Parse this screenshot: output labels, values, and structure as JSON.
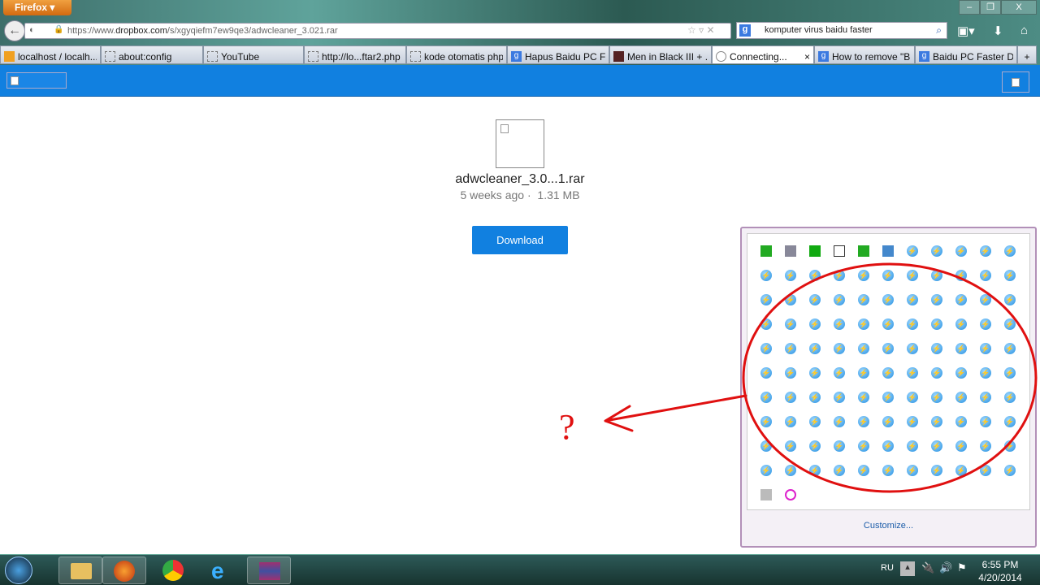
{
  "browser": {
    "menu_button": "Firefox",
    "window_controls": [
      "–",
      "❐",
      "X"
    ],
    "url_prefix": "https://www.",
    "url_domain": "dropbox.com",
    "url_path": "/s/xgyqiefm7ew9qe3/adwcleaner_3.021.rar",
    "search_value": "komputer virus baidu faster",
    "tabs": [
      {
        "label": "localhost / localh...",
        "icon": "pma"
      },
      {
        "label": "about:config",
        "icon": "blank"
      },
      {
        "label": "YouTube",
        "icon": "blank"
      },
      {
        "label": "http://lo...ftar2.php",
        "icon": "blank"
      },
      {
        "label": "kode otomatis php |",
        "icon": "blank"
      },
      {
        "label": "Hapus Baidu PC F...",
        "icon": "google"
      },
      {
        "label": "Men in Black III + ...",
        "icon": "film"
      },
      {
        "label": "Connecting...",
        "icon": "loading",
        "active": true
      },
      {
        "label": "How to remove \"B...",
        "icon": "google"
      },
      {
        "label": "Baidu PC Faster Di...",
        "icon": "google"
      }
    ],
    "new_tab": "+",
    "tab_close": "×"
  },
  "file": {
    "name": "adwcleaner_3.0...1.rar",
    "age": "5 weeks ago",
    "separator": "·",
    "size": "1.31 MB",
    "download_label": "Download"
  },
  "tray_popup": {
    "customize_label": "Customize...",
    "special_icons": [
      "green-check-icon",
      "plug-check-icon",
      "green-triangle-icon",
      "document-icon",
      "green-camera-icon",
      "blue-disk-icon"
    ],
    "row1_blue_count": 5,
    "full_rows": 9,
    "columns": 11,
    "last_row_icons": [
      "network-icon",
      "pink-swirl-icon"
    ],
    "blue_icon": "baidu-lightning-icon"
  },
  "annotation": {
    "text": "?",
    "color": "#e01010"
  },
  "taskbar": {
    "language": "RU",
    "time": "6:55 PM",
    "date": "4/20/2014",
    "apps": [
      "explorer",
      "firefox",
      "chrome",
      "internet-explorer",
      "winrar"
    ]
  },
  "colors": {
    "dropbox_blue": "#1180e0",
    "popup_border": "#b290b8"
  }
}
